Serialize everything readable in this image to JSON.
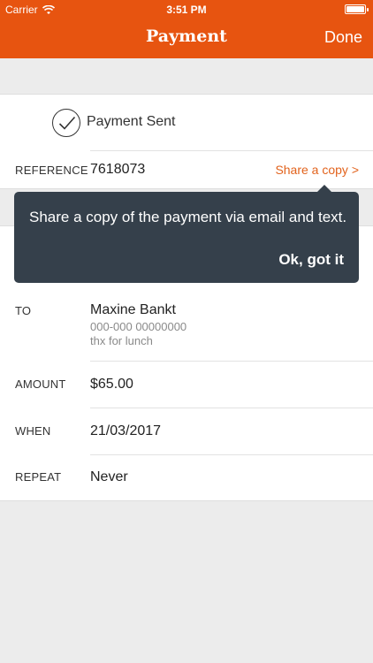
{
  "status_bar": {
    "carrier": "Carrier",
    "time": "3:51 PM"
  },
  "nav": {
    "title": "Payment",
    "done_label": "Done"
  },
  "payment": {
    "status_text": "Payment Sent",
    "reference_label": "REFERENCE",
    "reference_value": "7618073",
    "share_label": "Share a copy  >"
  },
  "tooltip": {
    "message": "Share a copy of the payment via email and text.",
    "ok_label": "Ok, got it"
  },
  "details": {
    "to_label": "TO",
    "to_name": "Maxine Bankt",
    "to_account": "000-000 00000000",
    "to_note": "thx for lunch",
    "amount_label": "AMOUNT",
    "amount_value": "$65.00",
    "when_label": "WHEN",
    "when_value": "21/03/2017",
    "repeat_label": "REPEAT",
    "repeat_value": "Never"
  },
  "colors": {
    "accent": "#e75410",
    "tooltip_bg": "#35404b",
    "link": "#e2631d"
  }
}
